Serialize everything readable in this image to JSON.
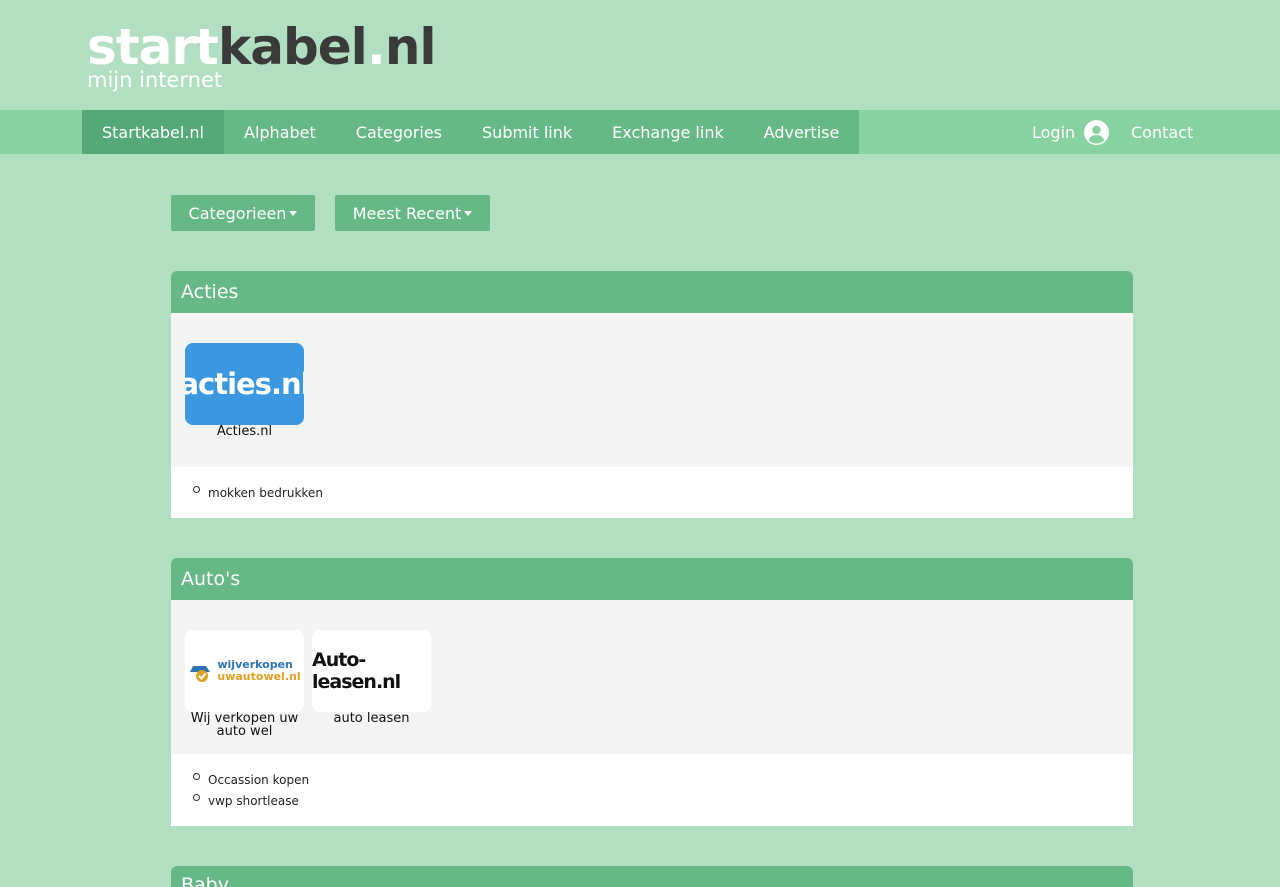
{
  "logo": {
    "part1": "start",
    "part2": "kabel",
    "dot": ".",
    "part3": "nl",
    "tagline": "mijn internet"
  },
  "nav": {
    "items": [
      "Startkabel.nl",
      "Alphabet",
      "Categories",
      "Submit link",
      "Exchange link",
      "Advertise"
    ],
    "login": "Login",
    "contact": "Contact"
  },
  "filters": {
    "categories": "Categorieen",
    "sort": "Meest Recent"
  },
  "sections": [
    {
      "title": "Acties",
      "tiles": [
        {
          "logo_text": "acties.nl",
          "caption": "Acties.nl"
        }
      ],
      "links": [
        "mokken bedrukken"
      ]
    },
    {
      "title": "Auto's",
      "tiles": [
        {
          "logo_text_1": "wijverkopen",
          "logo_text_2": "uwautowel.nl",
          "caption": "Wij verkopen uw auto wel"
        },
        {
          "logo_text": "Auto-leasen.nl",
          "caption": "auto leasen"
        }
      ],
      "links": [
        "Occassion kopen",
        "vwp shortlease"
      ]
    },
    {
      "title": "Baby"
    }
  ],
  "colors": {
    "background": "#b2dfc2",
    "nav": "#88d1a0",
    "accent": "#66b886",
    "active": "#55a877"
  }
}
